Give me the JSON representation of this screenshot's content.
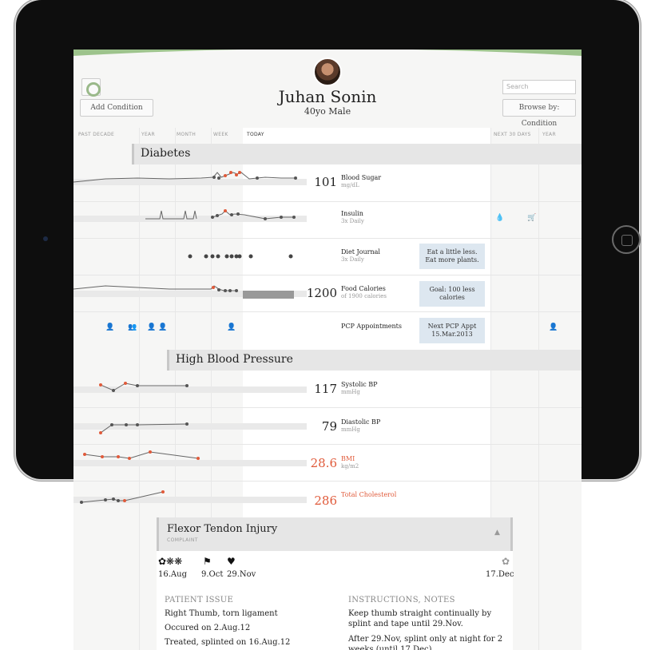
{
  "patient": {
    "name": "Juhan Sonin",
    "meta": "40yo  Male"
  },
  "header": {
    "add_condition": "Add Condition",
    "search_placeholder": "Search",
    "browse": "Browse by: Condition"
  },
  "timeline": {
    "past_decade": "PAST DECADE",
    "year": "YEAR",
    "month": "MONTH",
    "week": "WEEK",
    "today": "TODAY",
    "next_30": "NEXT 30 DAYS",
    "year_future": "YEAR"
  },
  "sections": {
    "diabetes": "Diabetes",
    "hbp": "High Blood Pressure"
  },
  "metrics": {
    "blood_sugar": {
      "value": "101",
      "name": "Blood Sugar",
      "unit": "mg/dL"
    },
    "insulin": {
      "name": "Insulin",
      "unit": "3x Daily"
    },
    "diet": {
      "name": "Diet Journal",
      "unit": "3x Daily",
      "note": "Eat a little less.\nEat more plants."
    },
    "calories": {
      "value": "1200",
      "name": "Food Calories",
      "unit": "of 1900 calories",
      "note": "Goal: 100 less calories"
    },
    "pcp": {
      "name": "PCP Appointments",
      "note": "Next PCP Appt\n15.Mar.2013"
    },
    "systolic": {
      "value": "117",
      "name": "Systolic BP",
      "unit": "mmHg"
    },
    "diastolic": {
      "value": "79",
      "name": "Diastolic BP",
      "unit": "mmHg"
    },
    "bmi": {
      "value": "28.6",
      "name": "BMI",
      "unit": "kg/m2"
    },
    "cholesterol": {
      "value": "286",
      "name": "Total Cholesterol"
    }
  },
  "injury": {
    "title": "Flexor Tendon Injury",
    "sub": "COMPLAINT",
    "dates": [
      "16.Aug",
      "9.Oct",
      "29.Nov",
      "17.Dec"
    ],
    "issue_title": "PATIENT ISSUE",
    "issue_lines": [
      "Right Thumb, torn ligament",
      "Occured on 2.Aug.12",
      "Treated, splinted on 16.Aug.12"
    ],
    "instr_title": "INSTRUCTIONS, NOTES",
    "instr_lines": [
      "Keep thumb straight continually by splint and tape until 29.Nov.",
      "After 29.Nov, splint only at night for 2 weeks (until 17.Dec)"
    ]
  },
  "colors": {
    "accent_green": "#9dc38c",
    "alert": "#e05a3a",
    "note_bg": "#dde7f0"
  },
  "icons": {
    "insulin_drop": "droplet-icon",
    "cart": "cart-icon",
    "person": "person-icon",
    "collapse": "chevron-up-icon"
  }
}
